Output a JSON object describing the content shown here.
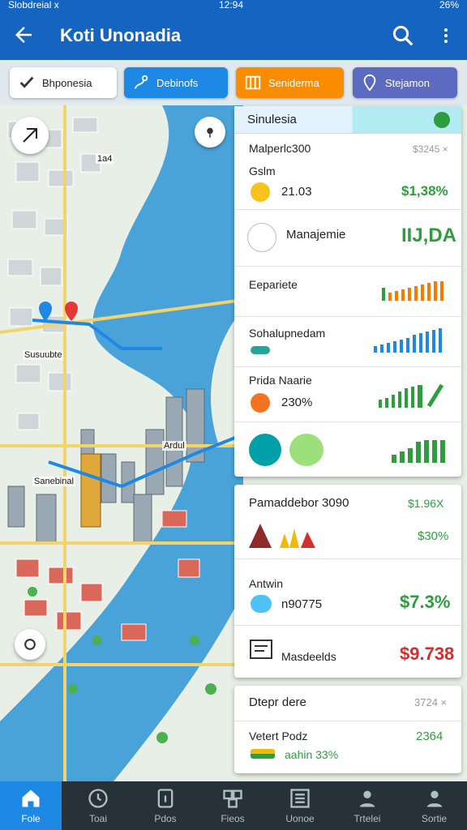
{
  "status_bar": {
    "left": "Slobdreial x",
    "center": "12:94",
    "right": "26%"
  },
  "app_bar": {
    "title": "Koti Unonadia"
  },
  "filters": [
    {
      "label": "Bhponesia",
      "icon": "check-icon"
    },
    {
      "label": "Debinofs",
      "icon": "route-icon"
    },
    {
      "label": "Seniderma",
      "icon": "bars-icon"
    },
    {
      "label": "Stejamon",
      "icon": "pin-icon"
    }
  ],
  "map": {
    "labels": [
      "Susuubte",
      "Sanebinal",
      "Ardul",
      "1a4"
    ]
  },
  "panel_main": {
    "header": "Sinulesia",
    "rows": [
      {
        "name": "Malperlc300",
        "sub": "Gslm",
        "value": "21.03",
        "meta": "$3245 ×",
        "amount": "$1,38%"
      },
      {
        "name": "Manajemie",
        "amount": "IIJ,DA"
      },
      {
        "name": "Eepariete"
      },
      {
        "name": "Sohalupnedam"
      },
      {
        "name": "Prida Naarie",
        "value": "230%"
      }
    ]
  },
  "panel_mid": {
    "rows": [
      {
        "name": "Pamaddebor 3090",
        "meta": "$1.96X",
        "amount": "$30%"
      },
      {
        "name": "Antwin",
        "value": "n90775",
        "amount": "$7.3%"
      },
      {
        "name": "Masdeelds",
        "amount": "$9.738"
      }
    ]
  },
  "panel_bottom": {
    "rows": [
      {
        "name": "Dtepr dere",
        "meta": "3724 ×"
      },
      {
        "name": "Vetert Podz",
        "meta": "2364",
        "value": "aahin 33%"
      }
    ]
  },
  "bottom_nav": [
    {
      "label": "Fole",
      "icon": "home-icon",
      "active": true
    },
    {
      "label": "Toai",
      "icon": "clock-icon"
    },
    {
      "label": "Pdos",
      "icon": "info-icon"
    },
    {
      "label": "Fieos",
      "icon": "gallery-icon"
    },
    {
      "label": "Uonoe",
      "icon": "list-icon"
    },
    {
      "label": "Trtelei",
      "icon": "person-icon"
    },
    {
      "label": "Sortie",
      "icon": "profile-icon"
    }
  ],
  "colors": {
    "primary": "#1565c0",
    "accent_green": "#2e9d3e",
    "accent_red": "#d32f2f",
    "water": "#4aa3d8"
  }
}
